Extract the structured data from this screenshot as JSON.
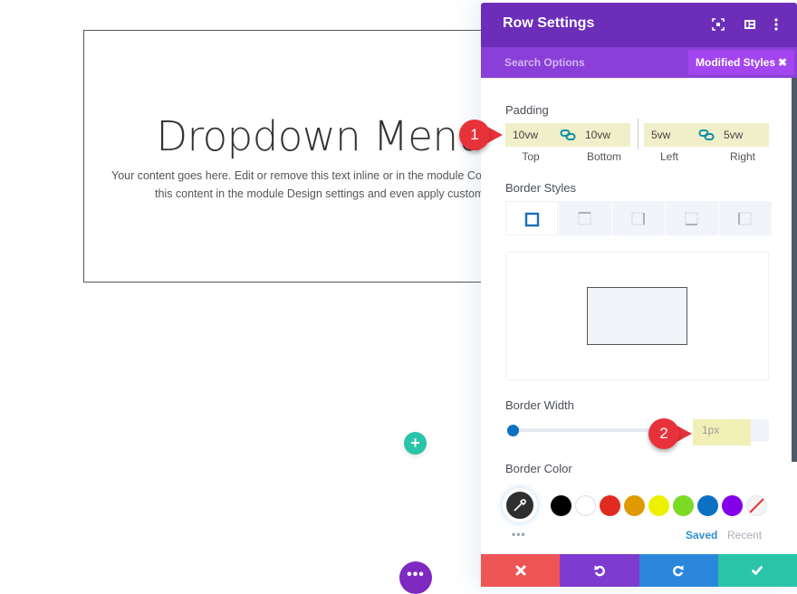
{
  "canvas": {
    "module_title": "Dropdown Menu",
    "module_text_line1": "Your content goes here. Edit or remove this text inline or in the module Content settings. You can also style every aspect of",
    "module_text_line2": "this content in the module Design settings and even apply custom CSS to this text in the module Advanced settings.",
    "add_button_icon": "plus-icon",
    "add_button_label": "+",
    "more_button_label": "•••"
  },
  "panel": {
    "title": "Row Settings",
    "header_icons": [
      "fullscreen-icon",
      "sidebar-layout-icon",
      "more-vertical-icon"
    ],
    "search_placeholder": "Search Options",
    "filter_chip": "Modified Styles",
    "filter_chip_close": "✖",
    "padding": {
      "label": "Padding",
      "fields": [
        {
          "name": "Top",
          "value": "10vw"
        },
        {
          "name": "Bottom",
          "value": "10vw"
        },
        {
          "name": "Left",
          "value": "5vw"
        },
        {
          "name": "Right",
          "value": "5vw"
        }
      ]
    },
    "border_styles": {
      "label": "Border Styles",
      "tabs": [
        "all-sides",
        "top",
        "right",
        "bottom",
        "left"
      ],
      "active_tab": "all-sides"
    },
    "border_width": {
      "label": "Border Width",
      "value": "1px",
      "slider_fraction": 0.01
    },
    "border_color": {
      "label": "Border Color",
      "swatches": [
        "#000000",
        "#ffffff",
        "#e02b20",
        "#e09900",
        "#edf000",
        "#7cda24",
        "#0c71c3",
        "#8300e9",
        "none"
      ],
      "more_label": "•••",
      "saved_label": "Saved",
      "recent_label": "Recent"
    },
    "footer": {
      "cancel_color": "#ef5555",
      "undo_color": "#7e3bd0",
      "redo_color": "#2b87da",
      "save_color": "#29c4a9"
    }
  },
  "callouts": [
    {
      "number": "1"
    },
    {
      "number": "2"
    }
  ],
  "colors": {
    "header_purple": "#6c2eb9",
    "subbar_purple": "#8a3fd8",
    "chip_purple": "#a346ef",
    "highlight_yellow": "#f1efc9",
    "callout_red": "#e8323a"
  }
}
